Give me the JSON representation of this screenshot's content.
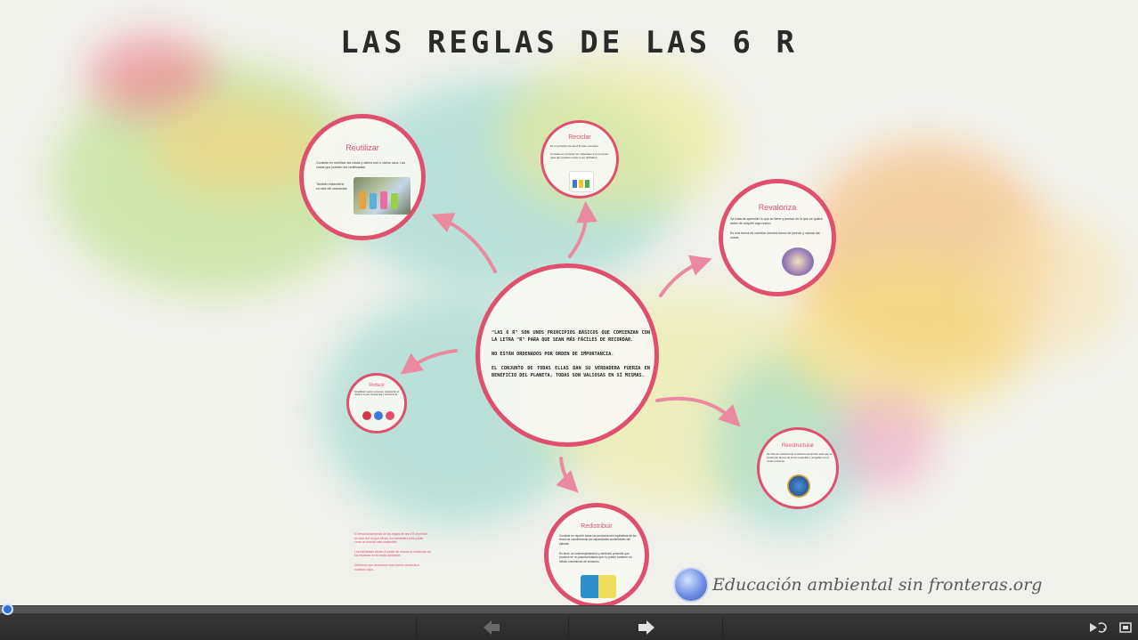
{
  "title": "LAS REGLAS DE LAS 6 R",
  "center": {
    "paragraphs": [
      "\"LAS 6 R\" SON UNOS PRINCIPIOS BÁSICOS QUE COMIENZAN CON LA LETRA \"R\" PARA QUE SEAN MÁS FÁCILES DE RECORDAR.",
      "NO ESTÁN ORDENADOS POR ORDEN DE IMPORTANCIA.",
      "EL CONJUNTO DE TODAS ELLAS DAN SU VERDADERA FUERZA EN BENEFICIO DEL PLANETA, TODAS SON VALIOSAS EN SÍ MISMAS."
    ]
  },
  "nodes": {
    "reutilizar": {
      "title": "Reutilizar",
      "text1": "Consiste en reutilizar las cosas y darles uno o varios usos. Las cosas que pueden ser reutilizadas:",
      "text2": "También extenderle su vida útil usándolas."
    },
    "reciclar": {
      "title": "Reciclar",
      "text1": "Es un principio de las 6 R más conocido.",
      "text2": "Consiste en someter los materiales a un proceso para que puedan volver a ser utilizados."
    },
    "revaloriza": {
      "title": "Revaloriza",
      "text1": "Se trata de aprender lo que se tiene y pensar en lo que se quiere antes de adquirir algo nuevo.",
      "text2": "Es una forma de cambiar nuestra forma de pensar y valorar las cosas."
    },
    "reducir": {
      "title": "Reducir",
      "text1": "Simplificar nuestro consumo, reduciendo al máximo lo que compramos y consumimos."
    },
    "reestructurar": {
      "title": "Reestructurar",
      "text1": "Se trata de reestructurar el sistema económico para que se produzcan bienes de forma sostenible y amigable con el medio ambiente."
    },
    "redistribuir": {
      "title": "Redistribuir",
      "text1": "Consiste en repartir todas las producciones equitativas de los recursos considerando las capacidades sustentables del planeta.",
      "text2": "Es decir, es sobreexplotándolo y teniendo presente que produce en un planeta limitado que no puede sostener un infinito crecimiento de consumo."
    }
  },
  "side_note": [
    "El tema fundamental de las reglas de las 6 R depende en todo del rol que tienen los habitantes para poder crear un mundo más sostenible.",
    "Los habitantes tienen el poder de reducir la incidencia de los residuos en el medio ambiente.",
    "Debemos que demostrar esta buena conducta a nuestros hijos."
  ],
  "logo": {
    "text": "Educación ambiental sin fronteras.org",
    "icon": "globe-icon"
  },
  "player": {
    "progress_fraction": 0.005,
    "prev_icon": "arrow-left-icon",
    "next_icon": "arrow-right-icon",
    "autoplay_icon": "autoplay-icon",
    "fullscreen_icon": "fullscreen-icon"
  },
  "colors": {
    "accent": "#e0506e",
    "background": "#f1f1ec",
    "toolbar": "#2f2f2f"
  }
}
